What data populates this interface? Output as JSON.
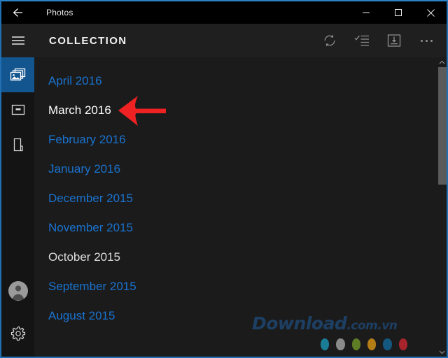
{
  "window": {
    "title": "Photos",
    "back_icon": "back-arrow-icon",
    "controls": [
      {
        "name": "minimize",
        "icon": "minimize-icon"
      },
      {
        "name": "maximize",
        "icon": "maximize-icon"
      },
      {
        "name": "close",
        "icon": "close-icon"
      }
    ],
    "border_color": "#1f6fb2"
  },
  "commandbar": {
    "menu_icon": "hamburger-menu-icon",
    "title": "COLLECTION",
    "actions": [
      {
        "name": "refresh",
        "icon": "refresh-icon"
      },
      {
        "name": "select",
        "icon": "select-checklist-icon"
      },
      {
        "name": "import",
        "icon": "import-icon"
      },
      {
        "name": "more",
        "icon": "ellipsis-icon"
      }
    ]
  },
  "rail": {
    "items": [
      {
        "name": "collection",
        "icon": "photos-stack-icon",
        "active": true
      },
      {
        "name": "albums",
        "icon": "album-icon",
        "active": false
      },
      {
        "name": "folders",
        "icon": "folder-page-icon",
        "active": false
      }
    ],
    "account": {
      "name": "account",
      "icon": "user-avatar-icon"
    },
    "settings": {
      "name": "settings",
      "icon": "gear-icon"
    }
  },
  "months": [
    {
      "label": "April 2016",
      "state": "link"
    },
    {
      "label": "March 2016",
      "state": "current"
    },
    {
      "label": "February 2016",
      "state": "link"
    },
    {
      "label": "January 2016",
      "state": "link"
    },
    {
      "label": "December 2015",
      "state": "link"
    },
    {
      "label": "November 2015",
      "state": "link"
    },
    {
      "label": "October 2015",
      "state": "plain"
    },
    {
      "label": "September 2015",
      "state": "link"
    },
    {
      "label": "August 2015",
      "state": "link"
    }
  ],
  "scrollbar": {
    "up_icon": "chevron-up-icon",
    "down_icon": "chevron-down-icon"
  },
  "annotation": {
    "arrow_color": "#ee2222",
    "points_at": "March 2016"
  },
  "watermark": {
    "main": "Download",
    "suffix": ".com.vn",
    "dot_colors": [
      "#1a7d96",
      "#8a8a8a",
      "#5f7d24",
      "#b57d16",
      "#14587f",
      "#a8242c"
    ]
  },
  "colors": {
    "link": "#1a73d0",
    "accent": "#12558f",
    "background": "#1b1b1b"
  }
}
